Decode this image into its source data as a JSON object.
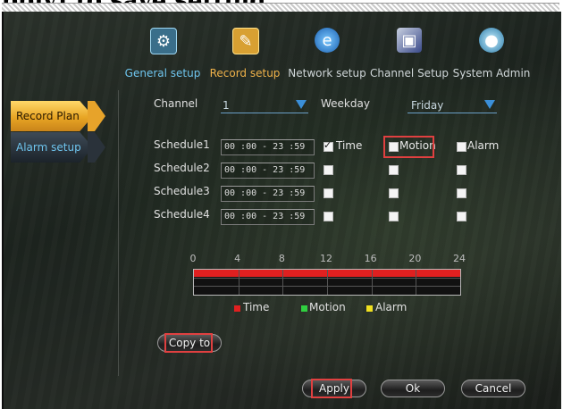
{
  "caption": "pply] to save setting.",
  "nav": {
    "tabs": [
      {
        "label": "General setup",
        "icon": "general-setup-icon"
      },
      {
        "label": "Record setup",
        "icon": "record-setup-icon"
      },
      {
        "label": "Network setup",
        "icon": "network-setup-icon"
      },
      {
        "label": "Channel Setup",
        "icon": "channel-setup-icon"
      },
      {
        "label": "System Admin",
        "icon": "system-admin-icon"
      }
    ]
  },
  "sidebar": {
    "items": [
      {
        "label": "Record Plan",
        "active": true
      },
      {
        "label": "Alarm setup",
        "active": false
      }
    ]
  },
  "form": {
    "channel_label": "Channel",
    "channel_value": "1",
    "weekday_label": "Weekday",
    "weekday_value": "Friday"
  },
  "schedules": [
    {
      "label": "Schedule1",
      "time": "00 :00 - 23 :59",
      "time_checked": true,
      "motion_checked": false,
      "alarm_checked": false
    },
    {
      "label": "Schedule2",
      "time": "00 :00 - 23 :59",
      "time_checked": false,
      "motion_checked": false,
      "alarm_checked": false
    },
    {
      "label": "Schedule3",
      "time": "00 :00 - 23 :59",
      "time_checked": false,
      "motion_checked": false,
      "alarm_checked": false
    },
    {
      "label": "Schedule4",
      "time": "00 :00 - 23 :59",
      "time_checked": false,
      "motion_checked": false,
      "alarm_checked": false
    }
  ],
  "record_types": {
    "time": "Time",
    "motion": "Motion",
    "alarm": "Alarm"
  },
  "timeline": {
    "ticks": [
      "0",
      "4",
      "8",
      "12",
      "16",
      "20",
      "24"
    ],
    "time_coverage": [
      0,
      24
    ]
  },
  "legend": [
    {
      "label": "Time",
      "color": "#e02020"
    },
    {
      "label": "Motion",
      "color": "#30d040"
    },
    {
      "label": "Alarm",
      "color": "#f0e020"
    }
  ],
  "buttons": {
    "copy_to": "Copy to",
    "apply": "Apply",
    "ok": "Ok",
    "cancel": "Cancel"
  },
  "colors": {
    "accent_orange": "#e8a524",
    "accent_blue": "#6fc6ef",
    "highlight_red": "#e04040",
    "timeline_red": "#e02020"
  }
}
